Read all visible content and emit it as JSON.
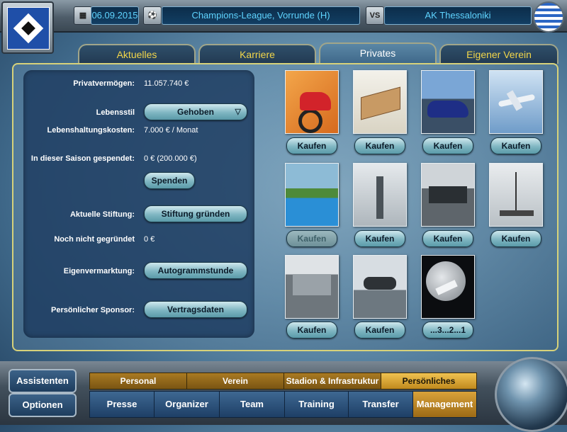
{
  "header": {
    "date": "06.09.2015",
    "competition": "Champions-League, Vorrunde (H)",
    "vs_label": "VS",
    "opponent": "AK Thessaloniki"
  },
  "tabs": [
    {
      "label": "Aktuelles"
    },
    {
      "label": "Karriere"
    },
    {
      "label": "Privates",
      "active": true
    },
    {
      "label": "Eigener Verein"
    }
  ],
  "info": {
    "privatvermoegen_label": "Privatvermögen:",
    "privatvermoegen_value": "11.057.740 €",
    "lebensstil_label": "Lebensstil",
    "lebensstil_value": "Gehoben",
    "lebenshaltung_label": "Lebenshaltungskosten:",
    "lebenshaltung_value": "7.000 € / Monat",
    "saison_label": "In dieser Saison gespendet:",
    "saison_value": "0 € (200.000 €)",
    "spenden_button": "Spenden",
    "stiftung_label": "Aktuelle Stiftung:",
    "stiftung_button": "Stiftung gründen",
    "nicht_gegruendet_label": "Noch nicht gegründet",
    "nicht_gegruendet_value": "0 €",
    "eigenvermarktung_label": "Eigenvermarktung:",
    "eigenvermarktung_button": "Autogrammstunde",
    "sponsor_label": "Persönlicher Sponsor:",
    "sponsor_button": "Vertragsdaten"
  },
  "items": [
    {
      "icon": "motorcycle-icon",
      "button": "Kaufen",
      "enabled": true
    },
    {
      "icon": "book-icon",
      "button": "Kaufen",
      "enabled": true
    },
    {
      "icon": "car-icon",
      "button": "Kaufen",
      "enabled": true
    },
    {
      "icon": "airplane-icon",
      "button": "Kaufen",
      "enabled": true
    },
    {
      "icon": "pool-villa-icon",
      "button": "Kaufen",
      "enabled": false
    },
    {
      "icon": "statue-of-liberty-icon",
      "button": "Kaufen",
      "enabled": true
    },
    {
      "icon": "chalet-icon",
      "button": "Kaufen",
      "enabled": true
    },
    {
      "icon": "sailboat-icon",
      "button": "Kaufen",
      "enabled": true
    },
    {
      "icon": "mansion-icon",
      "button": "Kaufen",
      "enabled": true
    },
    {
      "icon": "palm-island-icon",
      "button": "Kaufen",
      "enabled": true
    },
    {
      "icon": "space-shuttle-icon",
      "button": "...3...2...1",
      "enabled": true
    }
  ],
  "sidebar": {
    "assistenten": "Assistenten",
    "optionen": "Optionen"
  },
  "menu_top": [
    {
      "label": "Personal"
    },
    {
      "label": "Verein"
    },
    {
      "label": "Stadion & Infrastruktur"
    },
    {
      "label": "Persönliches",
      "active": true
    }
  ],
  "menu_bottom": [
    {
      "label": "Presse"
    },
    {
      "label": "Organizer"
    },
    {
      "label": "Team"
    },
    {
      "label": "Training"
    },
    {
      "label": "Transfer"
    },
    {
      "label": "Management",
      "active": true
    }
  ]
}
